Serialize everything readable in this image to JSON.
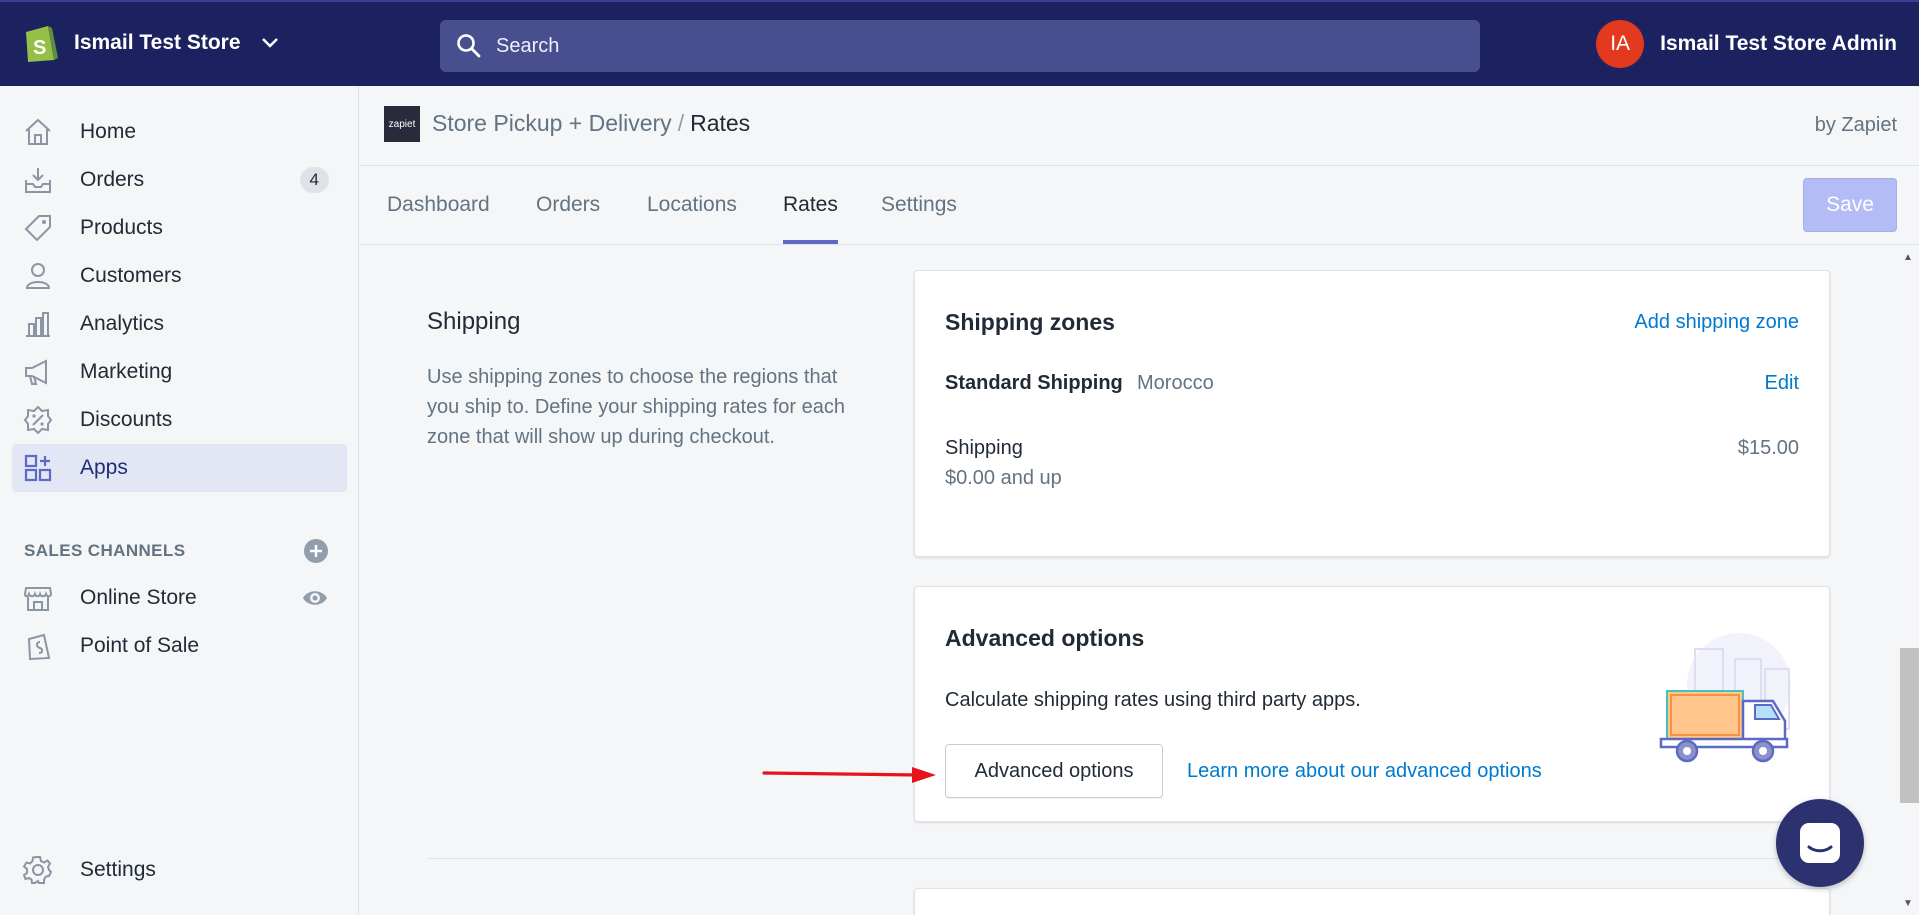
{
  "topbar": {
    "store_name": "Ismail Test Store",
    "search_placeholder": "Search",
    "avatar_initials": "IA",
    "account_name": "Ismail Test Store Admin"
  },
  "sidebar": {
    "items": [
      {
        "label": "Home",
        "icon": "home-icon"
      },
      {
        "label": "Orders",
        "icon": "orders-icon",
        "badge": "4"
      },
      {
        "label": "Products",
        "icon": "tag-icon"
      },
      {
        "label": "Customers",
        "icon": "person-icon"
      },
      {
        "label": "Analytics",
        "icon": "bar-chart-icon"
      },
      {
        "label": "Marketing",
        "icon": "megaphone-icon"
      },
      {
        "label": "Discounts",
        "icon": "discount-icon"
      },
      {
        "label": "Apps",
        "icon": "apps-icon",
        "active": true
      }
    ],
    "sales_channels_title": "SALES CHANNELS",
    "channels": [
      {
        "label": "Online Store",
        "icon": "store-icon"
      },
      {
        "label": "Point of Sale",
        "icon": "shopping-bag-icon"
      }
    ],
    "settings_label": "Settings"
  },
  "app_header": {
    "logo_text": "zapiet",
    "app_name": "Store Pickup + Delivery",
    "separator": "/",
    "current_page": "Rates",
    "byline": "by Zapiet"
  },
  "tabs": [
    {
      "label": "Dashboard"
    },
    {
      "label": "Orders"
    },
    {
      "label": "Locations"
    },
    {
      "label": "Rates",
      "active": true
    },
    {
      "label": "Settings"
    }
  ],
  "save_label": "Save",
  "shipping_section": {
    "title": "Shipping",
    "description": "Use shipping zones to choose the regions that you ship to. Define your shipping rates for each zone that will show up during checkout."
  },
  "zones_card": {
    "title": "Shipping zones",
    "add_link": "Add shipping zone",
    "zone_name": "Standard Shipping",
    "zone_country": "Morocco",
    "edit_link": "Edit",
    "rate_name": "Shipping",
    "rate_condition": "$0.00 and up",
    "rate_price": "$15.00"
  },
  "advanced_card": {
    "title": "Advanced options",
    "description": "Calculate shipping rates using third party apps.",
    "button_label": "Advanced options",
    "learn_link": "Learn more about our advanced options"
  },
  "colors": {
    "topbar": "#1c2260",
    "accent": "#5c6ac4",
    "link": "#007ace",
    "arrow": "#e5141b"
  }
}
